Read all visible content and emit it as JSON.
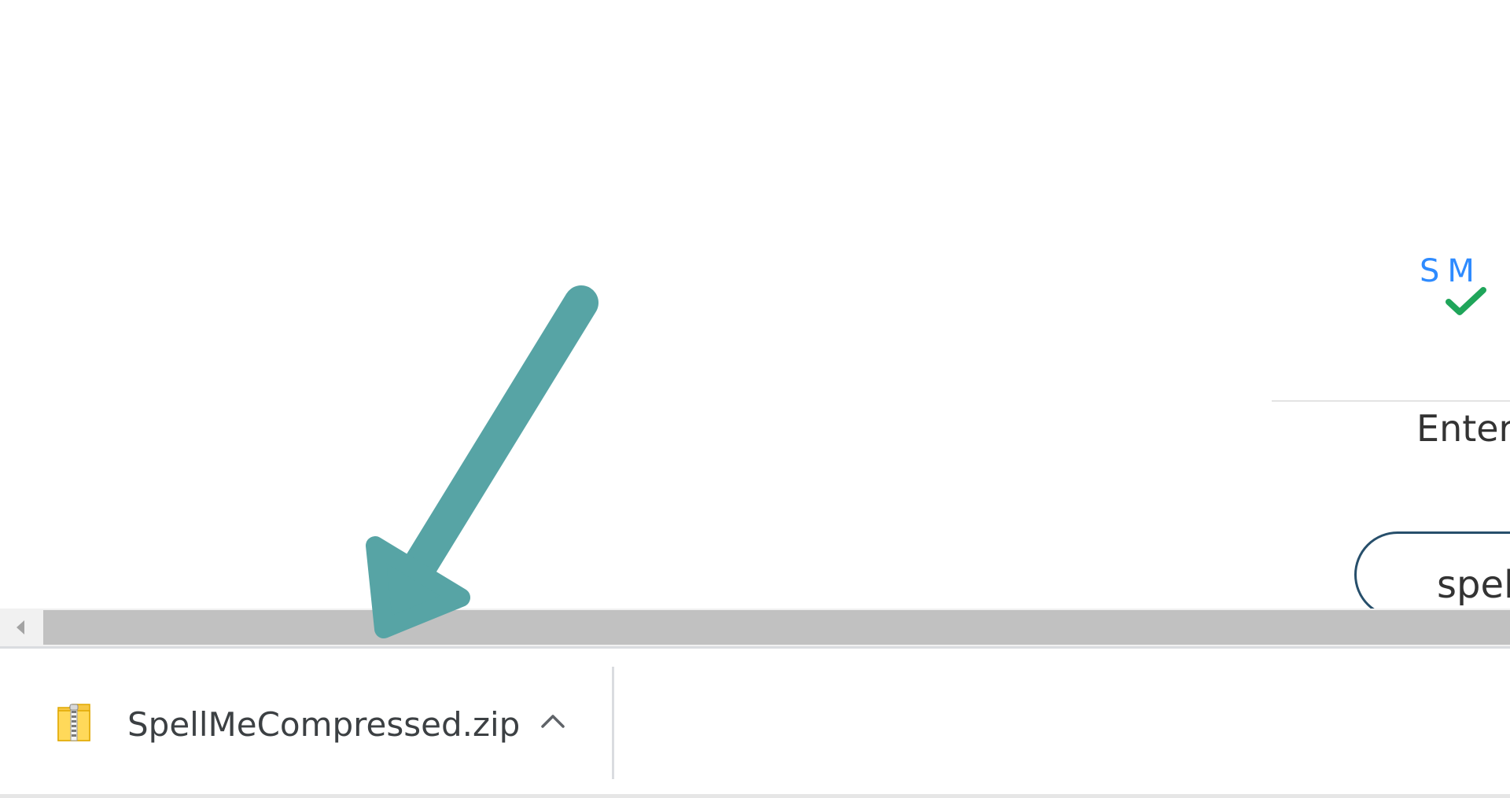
{
  "page": {
    "logo": {
      "letter_s": "S",
      "letter_m": "M"
    },
    "instruction_text": "Enter",
    "search_box_value": "spel"
  },
  "download_shelf": {
    "file_name": "SpellMeCompressed.zip"
  },
  "icons": {
    "logo_check": "check-icon",
    "file": "zip-file-icon",
    "toggle": "chevron-up-icon",
    "scroll": "scroll-left-arrow-icon",
    "annotation": "arrow-annotation"
  },
  "colors": {
    "logo_blue": "#2e8bff",
    "logo_check": "#1fa55a",
    "annotation_arrow": "#57a4a5",
    "search_border": "#274f6b",
    "scroll_thumb": "#c1c1c1"
  }
}
